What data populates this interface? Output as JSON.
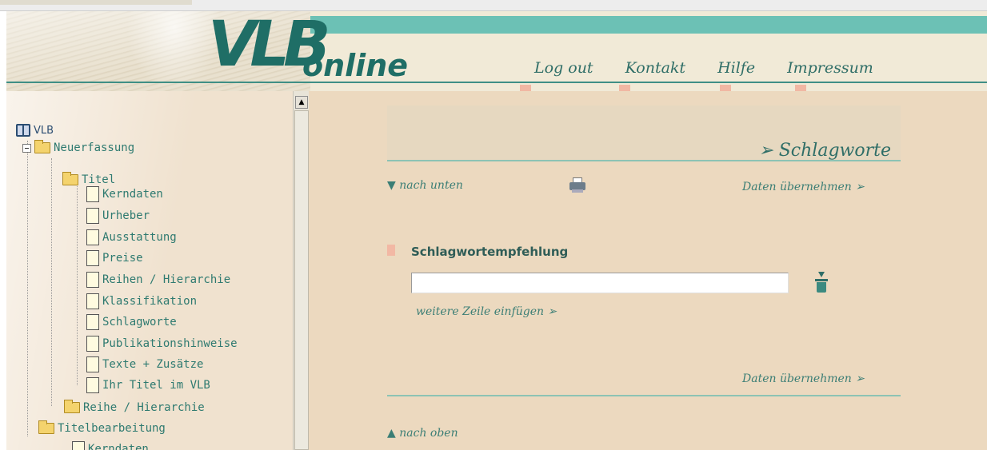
{
  "header": {
    "logo_vlb": "VLB",
    "logo_online": "online",
    "nav": [
      "Log out",
      "Kontakt",
      "Hilfe",
      "Impressum"
    ]
  },
  "tree": {
    "root": "VLB",
    "items": [
      {
        "label": "Neuerfassung",
        "type": "folder"
      },
      {
        "label": "Titel",
        "type": "folder"
      },
      {
        "label": "Kerndaten",
        "type": "doc"
      },
      {
        "label": "Urheber",
        "type": "doc"
      },
      {
        "label": "Ausstattung",
        "type": "doc"
      },
      {
        "label": "Preise",
        "type": "doc"
      },
      {
        "label": "Reihen / Hierarchie",
        "type": "doc"
      },
      {
        "label": "Klassifikation",
        "type": "doc"
      },
      {
        "label": "Schlagworte",
        "type": "doc"
      },
      {
        "label": "Publikationshinweise",
        "type": "doc"
      },
      {
        "label": "Texte + Zusätze",
        "type": "doc"
      },
      {
        "label": "Ihr Titel im VLB",
        "type": "doc"
      },
      {
        "label": "Reihe / Hierarchie",
        "type": "folder"
      },
      {
        "label": "Titelbearbeitung",
        "type": "folder"
      },
      {
        "label": "Kerndaten",
        "type": "doc"
      }
    ]
  },
  "main": {
    "section_title": "➢ Schlagworte",
    "nav_down": "nach unten",
    "nav_up": "nach oben",
    "apply_top": "Daten übernehmen ➢",
    "apply_bottom": "Daten übernehmen ➢",
    "field_label": "Schlagwortempfehlung",
    "field_value": "",
    "add_row": "weitere Zeile einfügen ➢"
  },
  "colors": {
    "teal": "#1f6e66",
    "teal_band": "#6cc1b5",
    "content_bg": "#ecd9bf",
    "marker": "#f2b8a4"
  }
}
